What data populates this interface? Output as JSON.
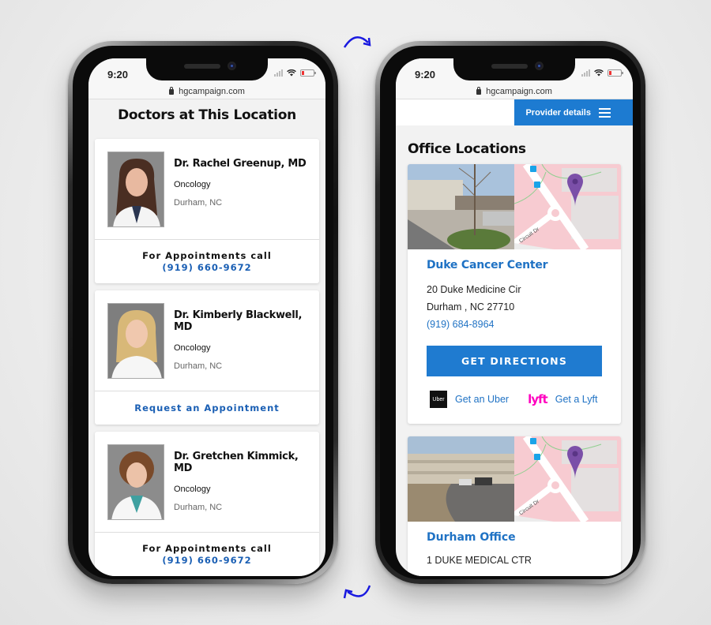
{
  "left_phone": {
    "status": {
      "time": "9:20",
      "url": "hgcampaign.com"
    },
    "page_title": "Doctors at This Location",
    "doctors": [
      {
        "name": "Dr. Rachel Greenup, MD",
        "specialty": "Oncology",
        "location": "Durham, NC",
        "cta_type": "call",
        "cta_label": "For Appointments call",
        "phone": "(919) 660-9672"
      },
      {
        "name": "Dr. Kimberly Blackwell, MD",
        "specialty": "Oncology",
        "location": "Durham, NC",
        "cta_type": "request",
        "cta_label": "Request an Appointment"
      },
      {
        "name": "Dr. Gretchen Kimmick, MD",
        "specialty": "Oncology",
        "location": "Durham, NC",
        "cta_type": "call",
        "cta_label": "For Appointments call",
        "phone": "(919) 660-9672"
      }
    ]
  },
  "right_phone": {
    "status": {
      "time": "9:20",
      "url": "hgcampaign.com"
    },
    "nav": {
      "provider_label": "Provider details",
      "menu_icon": "hamburger-icon"
    },
    "section_title": "Office Locations",
    "offices": [
      {
        "name": "Duke Cancer Center",
        "address_line1": "20 Duke Medicine Cir",
        "address_line2": "Durham , NC 27710",
        "phone": "(919) 684-8964",
        "directions_label": "GET DIRECTIONS",
        "uber_logo": "Uber",
        "uber_label": "Get an Uber",
        "lyft_logo": "lyft",
        "lyft_label": "Get a Lyft",
        "map_street_label": "Circuit Dr"
      },
      {
        "name": "Durham Office",
        "address_line1": "1 DUKE MEDICAL CTR",
        "map_street_label": "Circuit Dr"
      }
    ]
  },
  "colors": {
    "brand_blue": "#1f7bd0",
    "link_blue": "#1a5fb4",
    "lyft_pink": "#ff00bf",
    "map_pin": "#7b4fa8",
    "arrow_blue": "#1a1ae0"
  }
}
